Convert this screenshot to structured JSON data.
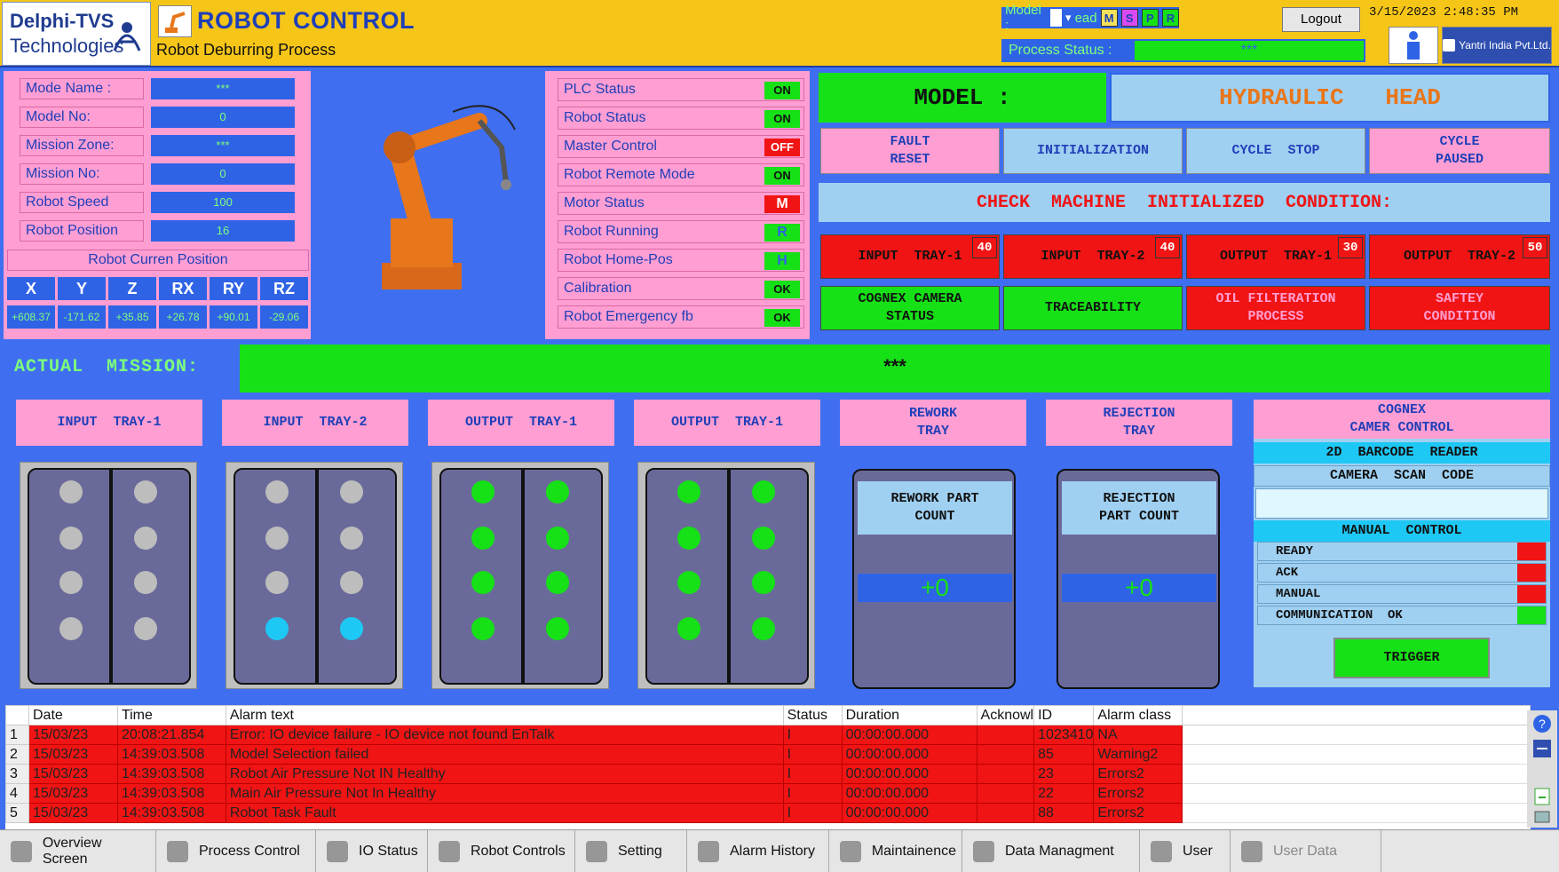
{
  "header": {
    "logo_line1": "Delphi-TVS",
    "logo_line2": "Technologies",
    "title": "ROBOT CONTROL",
    "subtitle": "Robot Deburring Process",
    "model_label": "Model :",
    "model_value_partial": "ead",
    "model_buttons": [
      "M",
      "S",
      "P",
      "R"
    ],
    "process_status_label": "Process Status :",
    "process_status_value": "***",
    "logout_label": "Logout",
    "datetime": "3/15/2023 2:48:35 PM",
    "company": "Yantri India Pvt.Ltd."
  },
  "info": {
    "rows": [
      {
        "label": "Mode Name :",
        "value": "***"
      },
      {
        "label": "Model No:",
        "value": "0"
      },
      {
        "label": "Mission Zone:",
        "value": "***"
      },
      {
        "label": "Mission No:",
        "value": "0"
      },
      {
        "label": "Robot Speed",
        "value": "100"
      },
      {
        "label": "Robot Position",
        "value": "16"
      }
    ],
    "position_title": "Robot Curren Position",
    "axes": [
      "X",
      "Y",
      "Z",
      "RX",
      "RY",
      "RZ"
    ],
    "axis_values": [
      "+608.37",
      "-171.62",
      "+35.85",
      "+26.78",
      "+90.01",
      "-29.06"
    ]
  },
  "status": {
    "rows": [
      {
        "label": "PLC Status",
        "value": "ON",
        "color": "#16e016"
      },
      {
        "label": "Robot  Status",
        "value": "ON",
        "color": "#16e016"
      },
      {
        "label": "Master Control",
        "value": "OFF",
        "color": "#f01414"
      },
      {
        "label": "Robot Remote Mode",
        "value": "ON",
        "color": "#16e016"
      },
      {
        "label": "Motor Status",
        "value": "M",
        "color": "#f01414"
      },
      {
        "label": "Robot Running",
        "value": "R",
        "color": "#16e016"
      },
      {
        "label": "Robot Home-Pos",
        "value": "H",
        "color": "#16e016"
      },
      {
        "label": "Calibration",
        "value": "OK",
        "color": "#16e016"
      },
      {
        "label": "Robot Emergency fb",
        "value": "OK",
        "color": "#16e016"
      }
    ]
  },
  "model": {
    "label": "MODEL :",
    "value": "HYDRAULIC   HEAD"
  },
  "actions": {
    "fault_reset": "FAULT\nRESET",
    "initialization": "INITIALIZATION",
    "cycle_stop": "CYCLE  STOP",
    "cycle_paused": "CYCLE\nPAUSED",
    "check_msg": "CHECK  MACHINE  INITIALIZED  CONDITION:"
  },
  "conditions": {
    "row1": [
      {
        "label": "INPUT  TRAY-1",
        "count": "40"
      },
      {
        "label": "INPUT  TRAY-2",
        "count": "40"
      },
      {
        "label": "OUTPUT  TRAY-1",
        "count": "30"
      },
      {
        "label": "OUTPUT  TRAY-2",
        "count": "50"
      }
    ],
    "row2": [
      {
        "label": "COGNEX  CAMERA\nSTATUS",
        "color": "#16e016"
      },
      {
        "label": "TRACEABILITY",
        "color": "#16e016"
      },
      {
        "label": "OIL  FILTERATION\nPROCESS",
        "color": "#f01414"
      },
      {
        "label": "SAFTEY\nCONDITION",
        "color": "#f01414"
      }
    ]
  },
  "mission": {
    "label": "ACTUAL  MISSION:",
    "value": "***"
  },
  "trays": [
    {
      "title": "INPUT  TRAY-1",
      "dots": [
        "#bdbdbd",
        "#bdbdbd",
        "#bdbdbd",
        "#bdbdbd",
        "#bdbdbd",
        "#bdbdbd",
        "#bdbdbd",
        "#bdbdbd"
      ]
    },
    {
      "title": "INPUT  TRAY-2",
      "dots": [
        "#bdbdbd",
        "#bdbdbd",
        "#bdbdbd",
        "#bdbdbd",
        "#bdbdbd",
        "#bdbdbd",
        "#1ec8f5",
        "#1ec8f5"
      ]
    },
    {
      "title": "OUTPUT  TRAY-1",
      "dots": [
        "#16e016",
        "#16e016",
        "#16e016",
        "#16e016",
        "#16e016",
        "#16e016",
        "#16e016",
        "#16e016"
      ]
    },
    {
      "title": "OUTPUT  TRAY-1",
      "dots": [
        "#16e016",
        "#16e016",
        "#16e016",
        "#16e016",
        "#16e016",
        "#16e016",
        "#16e016",
        "#16e016"
      ]
    }
  ],
  "rework": {
    "title": "REWORK\nTRAY",
    "head": "REWORK  PART\nCOUNT",
    "count": "+0"
  },
  "rejection": {
    "title": "REJECTION\nTRAY",
    "head": "REJECTION\nPART  COUNT",
    "count": "+0"
  },
  "cognex": {
    "title": "COGNEX\nCAMER  CONTROL",
    "barcode": "2D  BARCODE  READER",
    "scan": "CAMERA  SCAN  CODE",
    "scan_value": "",
    "manual": "MANUAL  CONTROL",
    "statuses": [
      {
        "label": "READY",
        "color": "#f01414"
      },
      {
        "label": "ACK",
        "color": "#f01414"
      },
      {
        "label": "MANUAL",
        "color": "#f01414"
      },
      {
        "label": "COMMUNICATION  OK",
        "color": "#16e016"
      }
    ],
    "trigger": "TRIGGER"
  },
  "alarms": {
    "columns": [
      "",
      "Date",
      "Time",
      "Alarm text",
      "Status",
      "Duration",
      "Acknowl",
      "ID",
      "Alarm class"
    ],
    "rows": [
      [
        "1",
        "15/03/23",
        "20:08:21.854",
        "Error: IO device failure - IO device not found     EnTalk",
        "I",
        "00:00:00.000",
        "",
        "1023410",
        "NA"
      ],
      [
        "2",
        "15/03/23",
        "14:39:03.508",
        "Model Selection failed",
        "I",
        "00:00:00.000",
        "",
        "85",
        "Warning2"
      ],
      [
        "3",
        "15/03/23",
        "14:39:03.508",
        "Robot Air Pressure Not IN Healthy",
        "I",
        "00:00:00.000",
        "",
        "23",
        "Errors2"
      ],
      [
        "4",
        "15/03/23",
        "14:39:03.508",
        "Main Air Pressure Not In Healthy",
        "I",
        "00:00:00.000",
        "",
        "22",
        "Errors2"
      ],
      [
        "5",
        "15/03/23",
        "14:39:03.508",
        "Robot Task Fault",
        "I",
        "00:00:00.000",
        "",
        "88",
        "Errors2"
      ]
    ]
  },
  "nav": [
    {
      "label": "Overview Screen",
      "icon": "overview-icon"
    },
    {
      "label": "Process Control",
      "icon": "process-icon"
    },
    {
      "label": "IO Status",
      "icon": "io-icon"
    },
    {
      "label": "Robot Controls",
      "icon": "robot-icon"
    },
    {
      "label": "Setting",
      "icon": "gear-icon"
    },
    {
      "label": "Alarm History",
      "icon": "alarm-icon"
    },
    {
      "label": "Maintainence",
      "icon": "tools-icon"
    },
    {
      "label": "Data Managment",
      "icon": "chart-icon"
    },
    {
      "label": "User",
      "icon": "user-icon"
    },
    {
      "label": "User Data",
      "icon": "user-data-icon"
    }
  ]
}
